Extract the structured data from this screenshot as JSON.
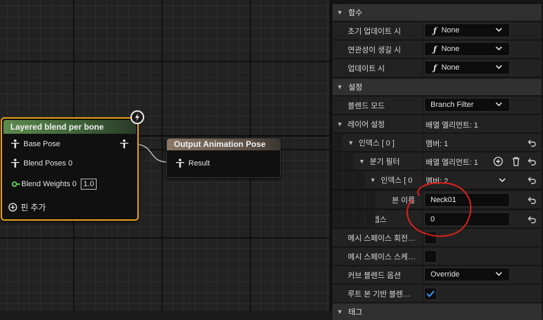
{
  "graph": {
    "layered_node": {
      "title": "Layered blend per bone",
      "pins": {
        "base_pose": "Base Pose",
        "blend_poses": "Blend Poses 0",
        "blend_weights": "Blend Weights 0",
        "blend_weights_value": "1.0",
        "add_pin": "핀 추가"
      }
    },
    "output_node": {
      "title": "Output Animation Pose",
      "pins": {
        "result": "Result"
      }
    }
  },
  "details": {
    "functions_category": "함수",
    "initial_update_label": "초기 업데이트 시",
    "initial_update_value": "None",
    "become_relevant_label": "연관성이 생길 시",
    "become_relevant_value": "None",
    "update_label": "업데이트 시",
    "update_value": "None",
    "settings_category": "설정",
    "blend_mode_label": "블렌드 모드",
    "blend_mode_value": "Branch Filter",
    "layer_setup_label": "레이어 설정",
    "layer_setup_value": "배열 엘리먼트: 1",
    "index0_label": "인덱스 [ 0 ]",
    "index0_value": "멤버: 1",
    "branch_filter_label": "분기 필터",
    "branch_filter_value": "배열 엘리먼트: 1",
    "index0b_label": "인덱스 [ 0",
    "index0b_value": "멤버: 2",
    "bone_name_label": "본 이름",
    "bone_name_value": "Neck01",
    "depth_label": "뎁스",
    "depth_value": "0",
    "mesh_space_rot_label": "메시 스페이스 회전…",
    "mesh_space_scale_label": "메시 스페이스 스케…",
    "curve_blend_label": "커브 블렌드 옵션",
    "curve_blend_value": "Override",
    "root_bone_label": "루트 본 기반 블렌…",
    "tags_category": "태그"
  },
  "colors": {
    "accent_selection": "#e8a317",
    "layered_header": "#5d8b4e",
    "output_header": "#8a7865",
    "pin_green": "#5cc94a",
    "checkbox_blue": "#2f8ae8",
    "annotation_red": "#e0201a"
  }
}
